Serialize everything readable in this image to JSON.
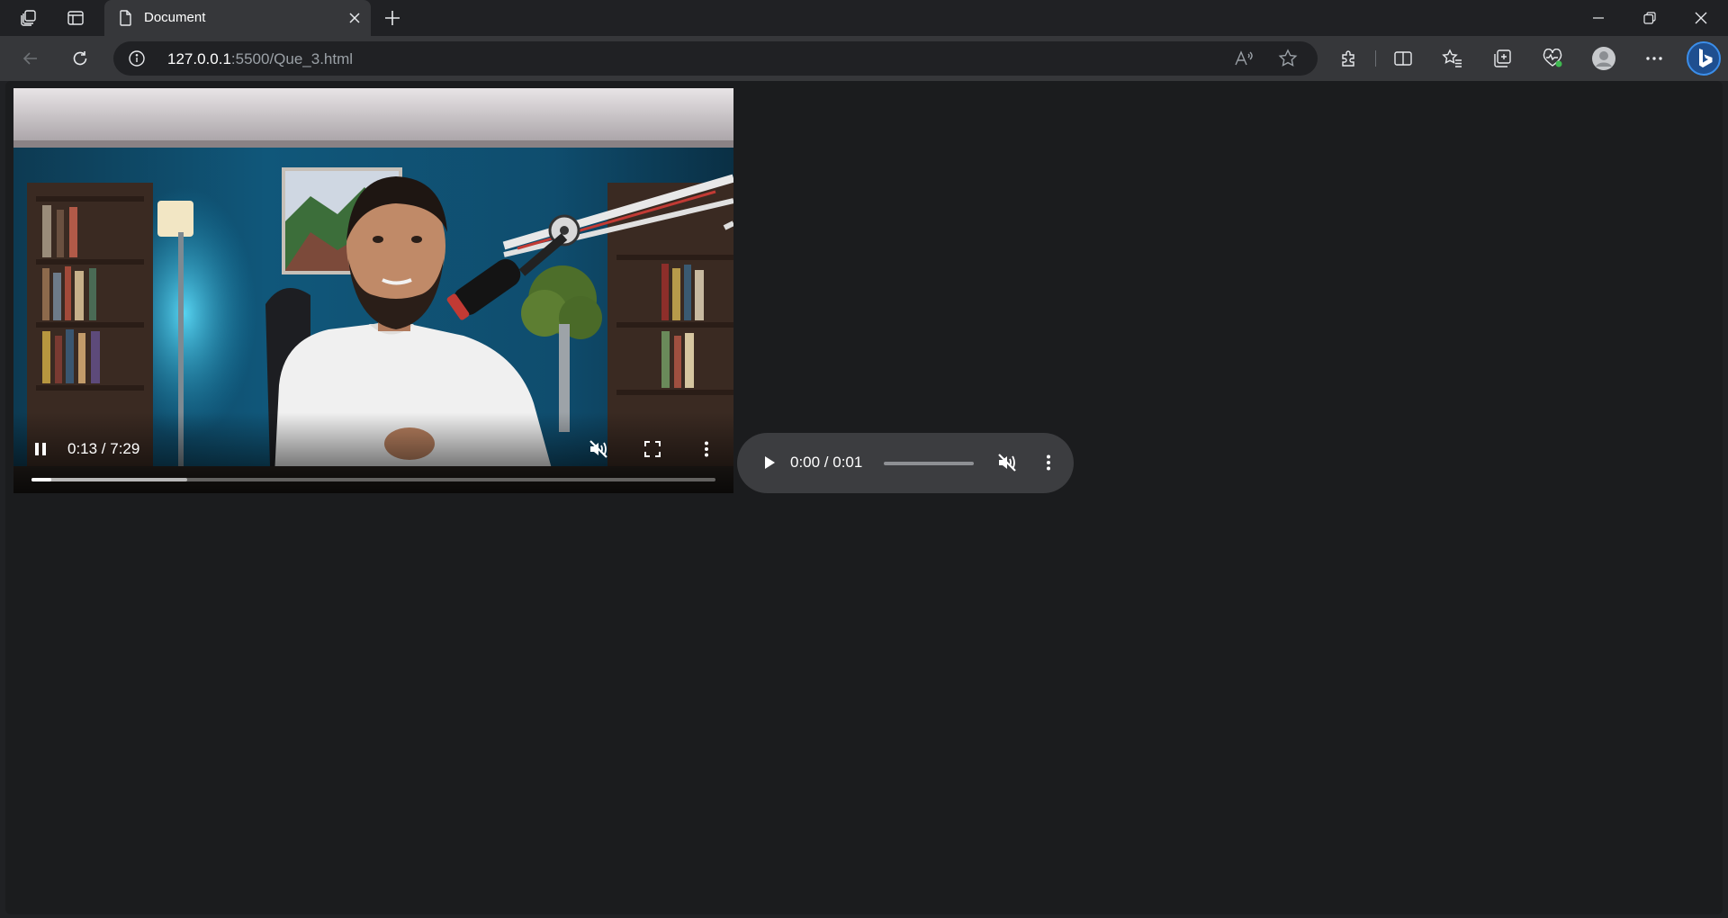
{
  "browser": {
    "tab": {
      "title": "Document"
    },
    "address": {
      "host": "127.0.0.1",
      "rest": ":5500/Que_3.html"
    }
  },
  "video": {
    "time_display": "0:13 / 7:29",
    "progress_fraction": 0.029,
    "buffered_fraction": 0.227
  },
  "audio": {
    "time_display": "0:00 / 0:01",
    "progress_fraction": 0.0
  }
}
